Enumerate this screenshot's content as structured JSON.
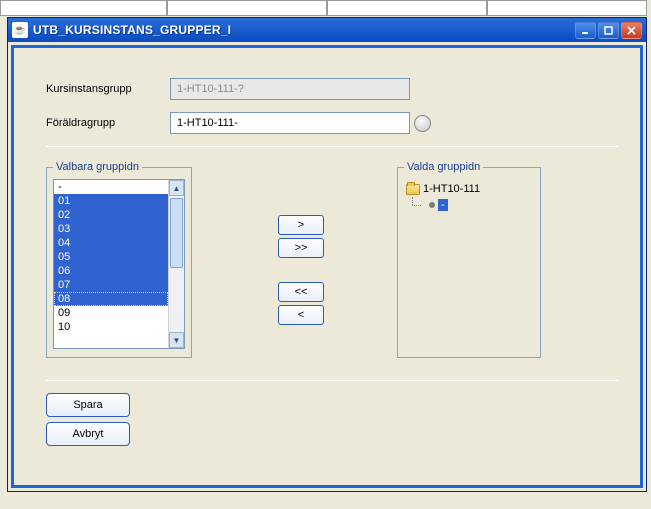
{
  "window": {
    "title": "UTB_KURSINSTANS_GRUPPER_I"
  },
  "form": {
    "kursinstansgrupp_label": "Kursinstansgrupp",
    "kursinstansgrupp_value": "1-HT10-111-?",
    "foraldragrupp_label": "Föräldragrupp",
    "foraldragrupp_value": "1-HT10-111-"
  },
  "valbara": {
    "legend": "Valbara gruppidn",
    "items": [
      "-",
      "01",
      "02",
      "03",
      "04",
      "05",
      "06",
      "07",
      "08",
      "09",
      "10"
    ]
  },
  "valda": {
    "legend": "Valda gruppidn",
    "root": "1-HT10-111",
    "child": "-"
  },
  "transfer": {
    "add_one": ">",
    "add_all": ">>",
    "remove_all": "<<",
    "remove_one": "<"
  },
  "buttons": {
    "save": "Spara",
    "cancel": "Avbryt"
  }
}
